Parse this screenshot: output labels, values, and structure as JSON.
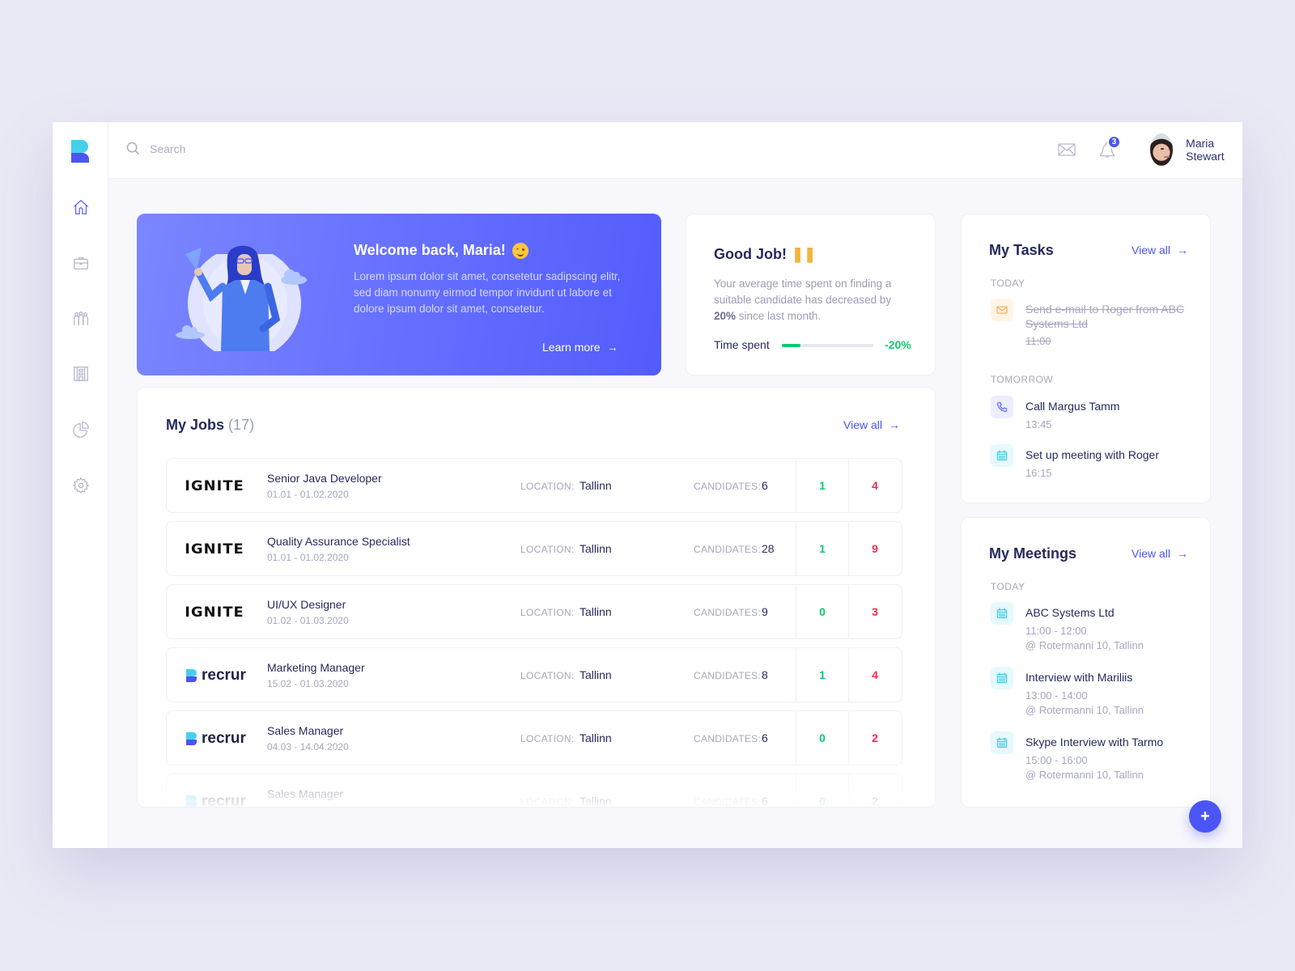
{
  "header": {
    "search_placeholder": "Search",
    "notifications_count": "3",
    "user_name": "Maria Stewart"
  },
  "sidebar": {
    "items": [
      {
        "name": "home",
        "icon": "home-icon",
        "active": true
      },
      {
        "name": "jobs",
        "icon": "briefcase-icon",
        "active": false
      },
      {
        "name": "candidates",
        "icon": "people-icon",
        "active": false
      },
      {
        "name": "companies",
        "icon": "building-icon",
        "active": false
      },
      {
        "name": "reports",
        "icon": "pie-chart-icon",
        "active": false
      },
      {
        "name": "settings",
        "icon": "gear-icon",
        "active": false
      }
    ]
  },
  "welcome": {
    "title": "Welcome back, Maria!",
    "body": "Lorem ipsum dolor sit amet, consetetur sadipscing elitr, sed diam nonumy eirmod tempor invidunt ut labore et dolore ipsum dolor sit amet, consetetur.",
    "link": "Learn more"
  },
  "goodjob": {
    "title": "Good Job!",
    "body_pre": "Your average time spent on finding a suitable candidate has decreased by ",
    "body_bold": "20%",
    "body_post": " since last month.",
    "metric_label": "Time spent",
    "metric_value": "-20%",
    "progress_fraction": 0.2,
    "accent": "#10c873"
  },
  "jobs": {
    "title": "My Jobs",
    "count": "(17)",
    "view_all": "View all",
    "location_label": "LOCATION:",
    "candidates_label": "CANDIDATES:",
    "rows": [
      {
        "company": "IGNITE",
        "logo": "ignite",
        "title": "Senior Java Developer",
        "dates": "01.01 - 01.02.2020",
        "location": "Tallinn",
        "candidates": "6",
        "green": "1",
        "red": "4"
      },
      {
        "company": "IGNITE",
        "logo": "ignite",
        "title": "Quality Assurance Specialist",
        "dates": "01.01 - 01.02.2020",
        "location": "Tallinn",
        "candidates": "28",
        "green": "1",
        "red": "9"
      },
      {
        "company": "IGNITE",
        "logo": "ignite",
        "title": "UI/UX Designer",
        "dates": "01.02 - 01.03.2020",
        "location": "Tallinn",
        "candidates": "9",
        "green": "0",
        "red": "3"
      },
      {
        "company": "recrur",
        "logo": "recrur",
        "title": "Marketing Manager",
        "dates": "15.02 - 01.03.2020",
        "location": "Tallinn",
        "candidates": "8",
        "green": "1",
        "red": "4"
      },
      {
        "company": "recrur",
        "logo": "recrur",
        "title": "Sales Manager",
        "dates": "04.03 - 14.04.2020",
        "location": "Tallinn",
        "candidates": "6",
        "green": "0",
        "red": "2"
      },
      {
        "company": "recrur",
        "logo": "recrur",
        "title": "Sales Manager",
        "dates": "",
        "location": "Tallinn",
        "candidates": "6",
        "green": "0",
        "red": "2"
      }
    ]
  },
  "tasks": {
    "title": "My Tasks",
    "view_all": "View all",
    "groups": [
      {
        "label": "TODAY",
        "items": [
          {
            "icon": "mail-icon",
            "color": "orange",
            "title": "Send e-mail to Roger from ABC Systems Ltd",
            "time": "11:00",
            "done": true
          }
        ]
      },
      {
        "label": "TOMORROW",
        "items": [
          {
            "icon": "phone-icon",
            "color": "purple",
            "title": "Call Margus Tamm",
            "time": "13:45",
            "done": false
          },
          {
            "icon": "calendar-icon",
            "color": "cyan",
            "title": "Set up meeting with Roger",
            "time": "16:15",
            "done": false
          }
        ]
      }
    ]
  },
  "meetings": {
    "title": "My Meetings",
    "view_all": "View all",
    "group_label": "TODAY",
    "items": [
      {
        "title": "ABC Systems Ltd",
        "time": "11:00 - 12:00",
        "place": "@ Rotermanni 10, Tallinn"
      },
      {
        "title": "Interview with Mariliis",
        "time": "13:00 - 14:00",
        "place": "@ Rotermanni 10, Tallinn"
      },
      {
        "title": "Skype Interview with Tarmo",
        "time": "15:00 - 16:00",
        "place": "@ Rotermanni 10, Tallinn"
      }
    ]
  },
  "fab": {
    "label": "+"
  },
  "colors": {
    "primary": "#4b55f5",
    "success": "#10c873",
    "danger": "#f5284f",
    "text": "#252a5c"
  }
}
